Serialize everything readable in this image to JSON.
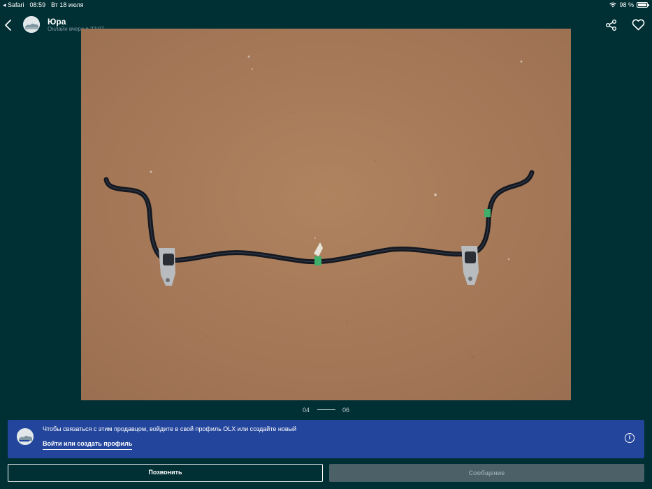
{
  "status_bar": {
    "app": "Safari",
    "time": "08:59",
    "date": "Вт 18 июля",
    "battery": "98 %",
    "battery_level": 0.98
  },
  "header": {
    "seller_name": "Юра",
    "seller_status": "Онлайн вчера в 22:07",
    "back_icon": "chevron-left-icon",
    "share_icon": "share-icon",
    "favorite_icon": "heart-icon"
  },
  "gallery": {
    "current": "04",
    "total": "06"
  },
  "login_banner": {
    "text": "Чтобы связаться с этим продавцом, войдите в свой профиль OLX или создайте новый",
    "link": "Войти или создать профиль",
    "info_icon": "info-icon"
  },
  "actions": {
    "call": "Позвонить",
    "message": "Сообщение"
  },
  "colors": {
    "background": "#002f34",
    "banner": "#23459c",
    "disabled_button": "#4b6167"
  }
}
